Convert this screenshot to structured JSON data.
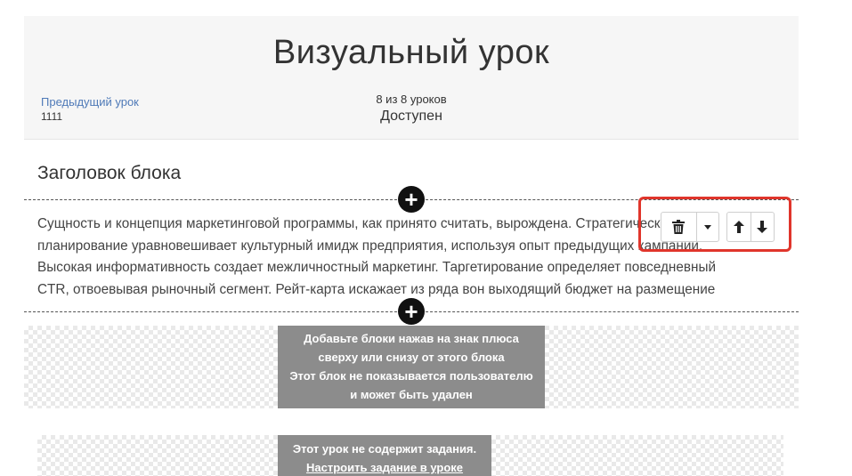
{
  "header": {
    "title": "Визуальный урок",
    "prev_label": "Предыдущий урок",
    "prev_value": "1111",
    "progress_count": "8 из 8 уроков",
    "progress_status": "Доступен"
  },
  "block": {
    "heading": "Заголовок блока",
    "body_lines": [
      "Сущность и концепция маркетинговой программы, как принято считать, вырождена. Стратегическое",
      "планирование уравновешивает культурный имидж предприятия, используя опыт предыдущих кампаний.",
      "Высокая информативность создает межличностный маркетинг. Таргетирование определяет повседневный",
      "CTR, отвоевывая рыночный сегмент. Рейт-карта искажает из ряда вон выходящий бюджет на размещение"
    ]
  },
  "toolbar": {
    "delete_icon": "trash-icon",
    "dropdown_icon": "caret-down-icon",
    "up_icon": "arrow-up-icon",
    "down_icon": "arrow-down-icon",
    "highlight_color": "#e0352b"
  },
  "add_blocks_notice": {
    "lines": [
      "Добавьте блоки нажав на знак плюса",
      "сверху или снизу от этого блока",
      "Этот блок не показывается пользователю",
      "и может быть удален"
    ]
  },
  "task_notice": {
    "text": "Этот урок не содержит задания.",
    "link": "Настроить задание в уроке"
  }
}
